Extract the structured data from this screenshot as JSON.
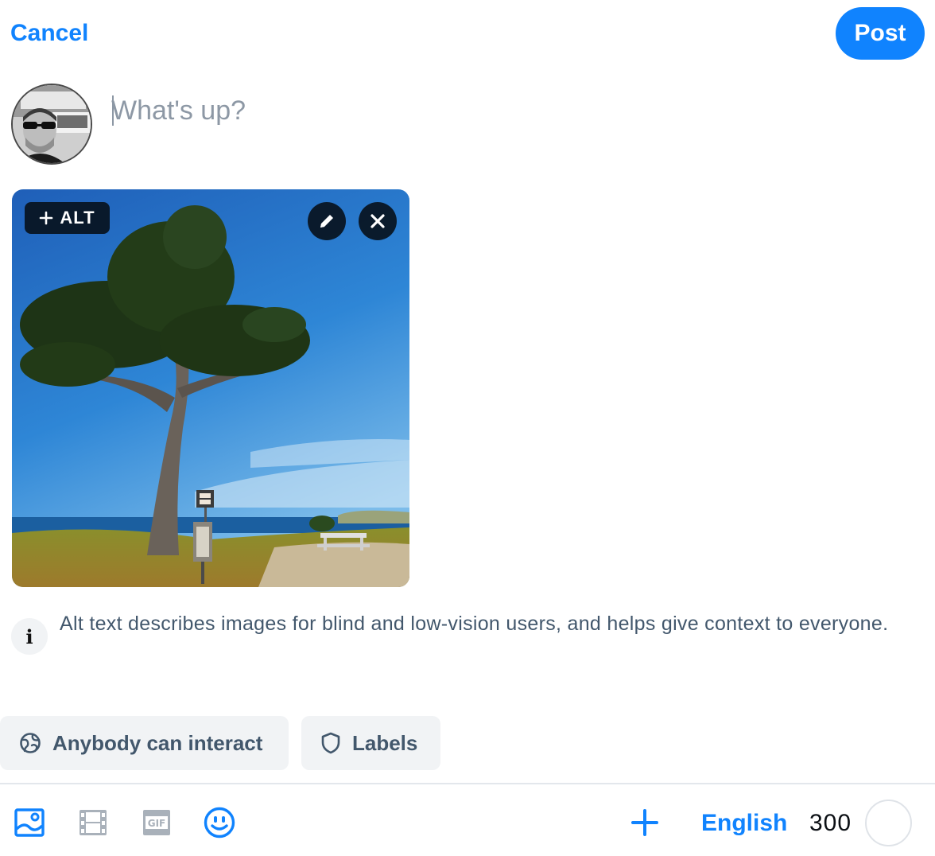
{
  "header": {
    "cancel_label": "Cancel",
    "post_label": "Post"
  },
  "composer": {
    "placeholder": "What's up?",
    "value": ""
  },
  "attachment": {
    "alt_label": "ALT",
    "alt_icon": "plus-icon",
    "edit_icon": "pencil-icon",
    "remove_icon": "close-icon"
  },
  "info": {
    "icon": "info-icon",
    "text": "Alt text describes images for blind and low-vision users, and helps give context to everyone."
  },
  "settings": {
    "interaction_label": "Anybody can interact",
    "interaction_icon": "globe-icon",
    "labels_label": "Labels",
    "labels_icon": "shield-icon"
  },
  "toolbar": {
    "tools": [
      "image-icon",
      "video-icon",
      "gif-icon",
      "emoji-icon"
    ],
    "add_icon": "plus-icon",
    "language": "English",
    "char_count": "300",
    "char_progress": 0
  },
  "colors": {
    "accent": "#1083fe",
    "muted_text": "#42576c",
    "chip_bg": "#f1f3f5",
    "placeholder": "#8d98a5"
  }
}
